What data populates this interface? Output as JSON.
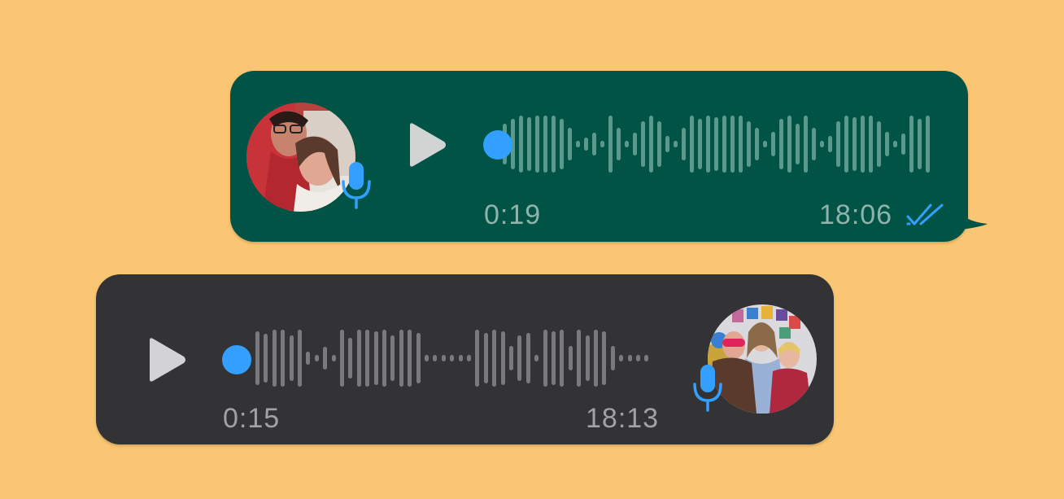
{
  "colors": {
    "background": "#fbc673",
    "outgoing_bubble": "#005345",
    "incoming_bubble": "#333335",
    "accent_blue": "#33a0ff",
    "outgoing_wave": "#5a9a8c",
    "incoming_wave": "#7a7a7e"
  },
  "messages": [
    {
      "direction": "outgoing",
      "type": "voice-note",
      "duration": "0:19",
      "time": "18:06",
      "status": "read",
      "playback_progress": 0,
      "icons": [
        "avatar-photo",
        "mic-icon",
        "play-icon",
        "read-double-check-icon"
      ]
    },
    {
      "direction": "incoming",
      "type": "voice-note",
      "duration": "0:15",
      "time": "18:13",
      "playback_progress": 0,
      "icons": [
        "play-icon",
        "avatar-photo",
        "mic-icon"
      ]
    }
  ]
}
